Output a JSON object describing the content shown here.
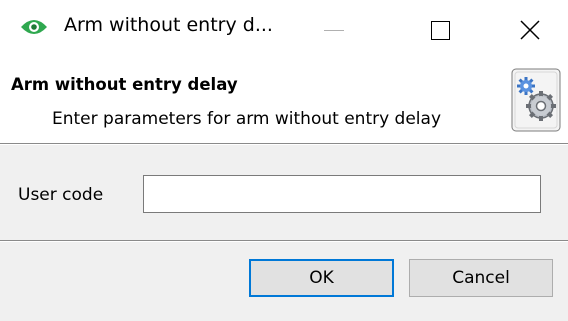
{
  "window": {
    "title": "Arm without entry d...",
    "app_icon": "eye-icon",
    "controls": {
      "minimize_icon": "minimize-icon",
      "maximize_icon": "maximize-icon",
      "close_icon": "close-icon"
    }
  },
  "header": {
    "title": "Arm without entry delay",
    "subtitle": "Enter parameters for arm without entry delay",
    "icon": "settings-gears-icon"
  },
  "form": {
    "user_code_label": "User code",
    "user_code_value": ""
  },
  "buttons": {
    "ok_label": "OK",
    "cancel_label": "Cancel"
  },
  "colors": {
    "app_icon_green": "#2fa84f",
    "ok_focus_border": "#0078d7",
    "panel_background": "#f0f0f0"
  }
}
